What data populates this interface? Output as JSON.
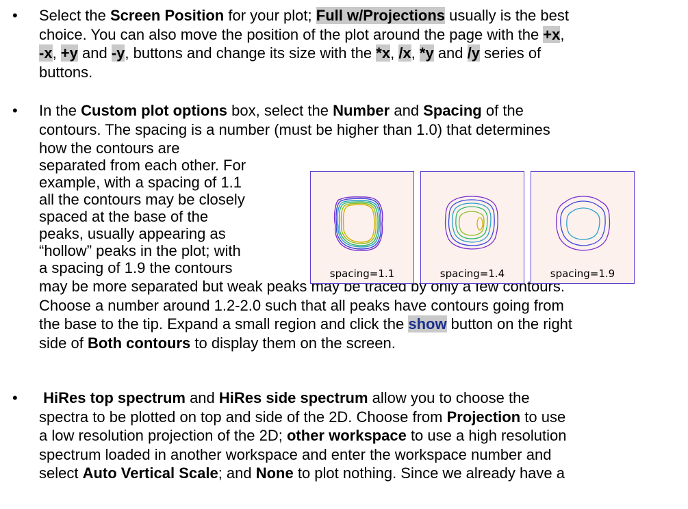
{
  "bullets": {
    "b1": {
      "l1": {
        "a": "Select the ",
        "b": "Screen Position",
        "c": " for your plot; ",
        "d": "Full w/Projections",
        "e": " usually is the best"
      },
      "l2": {
        "a": "choice.  You can also move the position of the plot around the page with the  ",
        "b": "+x",
        "c": ","
      },
      "l3": {
        "a": "-x",
        "b": ", ",
        "c": "+y",
        "d": " and ",
        "e": "-y",
        "f": ", buttons and change its size with the ",
        "g": "*x",
        "h": ", ",
        "i": "/x",
        "j": ", ",
        "k": "*y",
        "l": " and ",
        "m": "/y",
        "n": " series of"
      },
      "l4": "buttons."
    },
    "b2": {
      "l1": {
        "a": "In the ",
        "b": "Custom plot options",
        "c": " box, select the ",
        "d": "Number",
        "e": " and ",
        "f": "Spacing",
        "g": " of the"
      },
      "l2": "contours.  The spacing is a number (must be higher than 1.0) that determines",
      "l3": "how the contours are",
      "l4": "separated from each other. For",
      "l5": "example, with a spacing of 1.1",
      "l6": "all the contours may be closely",
      "l7": "spaced at the base of the",
      "l8": "peaks, usually appearing as",
      "l9": "“hollow” peaks in the plot; with",
      "l10": "a spacing of 1.9 the contours",
      "l11": "may be more separated but weak peaks may be traced by only a few contours.",
      "l12": "Choose a number around 1.2-2.0 such that all peaks have contours going from",
      "l13": {
        "a": "the base to the tip.  Expand a small region and click the ",
        "b": "show",
        "c": " button on the right"
      },
      "l14": {
        "a": "side of ",
        "b": "Both contours",
        "c": " to display them on the screen."
      }
    },
    "b3": {
      "l1": {
        "a": "HiRes top spectrum",
        "b": " and ",
        "c": "HiRes side spectrum",
        "d": " allow you to choose the"
      },
      "l2": "spectra to be plotted on top and side of the 2D.  Choose from ",
      "l2b": "Projection",
      "l2c": " to use",
      "l3": {
        "a": "a low resolution projection of the 2D; ",
        "b": "other workspace",
        "c": " to use a high resolution"
      },
      "l4": "spectrum loaded in another workspace and enter the workspace number and",
      "l5": {
        "a": "select ",
        "b": "Auto Vertical Scale",
        "c": "; and ",
        "d": "None",
        "e": " to plot nothing.  Since we already have a"
      }
    }
  },
  "figures": [
    {
      "caption": "spacing=1.1"
    },
    {
      "caption": "spacing=1.4"
    },
    {
      "caption": "spacing=1.9"
    }
  ],
  "bullet_symbol": "•"
}
